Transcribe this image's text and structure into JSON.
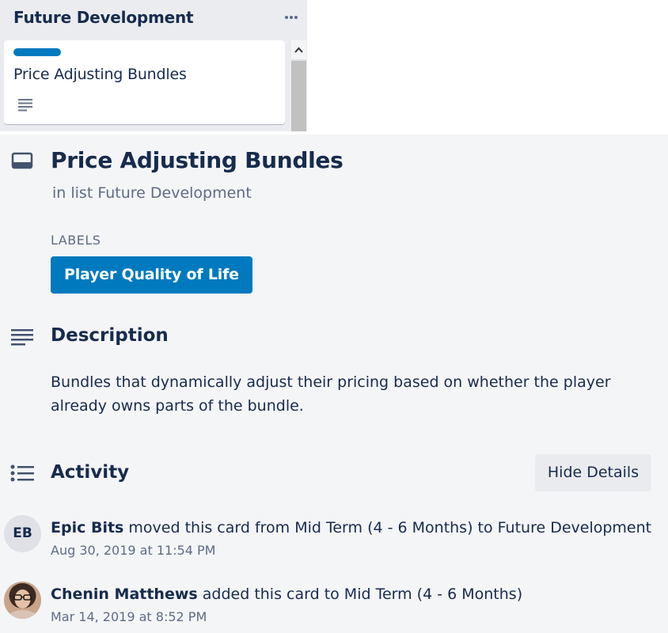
{
  "list": {
    "title": "Future Development",
    "menu_icon": "ellipsis-icon",
    "card": {
      "label_color": "#0079bf",
      "title": "Price Adjusting Bundles",
      "badge_icon": "description-icon"
    }
  },
  "card_detail": {
    "title": "Price Adjusting Bundles",
    "in_list_prefix": "in list",
    "in_list_name": "Future Development",
    "labels_heading": "LABELS",
    "labels": [
      {
        "name": "Player Quality of Life",
        "color": "#0079bf"
      }
    ],
    "description": {
      "heading": "Description",
      "text": "Bundles that dynamically adjust their pricing based on whether the player already owns parts of the bundle."
    },
    "activity": {
      "heading": "Activity",
      "hide_details_label": "Hide Details",
      "items": [
        {
          "member": "Epic Bits",
          "initials": "EB",
          "action": "moved this card from Mid Term (4 - 6 Months) to Future Development",
          "timestamp": "Aug 30, 2019 at 11:54 PM"
        },
        {
          "member": "Chenin Matthews",
          "initials": "",
          "action": "added this card to Mid Term (4 - 6 Months)",
          "timestamp": "Mar 14, 2019 at 8:52 PM"
        }
      ]
    }
  },
  "colors": {
    "accent": "#0079bf",
    "text_primary": "#172b4d",
    "text_secondary": "#5e6c84",
    "list_background": "#ebecf0",
    "detail_background": "#f4f5f7"
  }
}
